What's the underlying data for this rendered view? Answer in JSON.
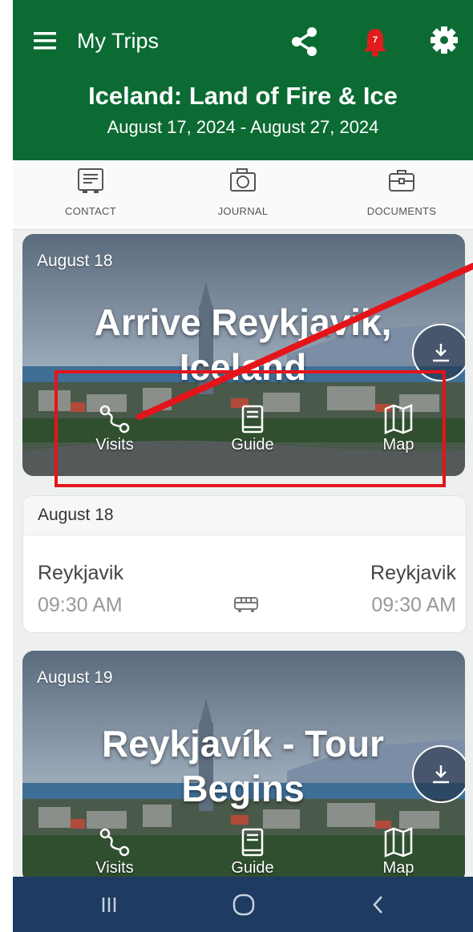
{
  "header": {
    "app_title": "My Trips",
    "notification_count": "7",
    "trip_title": "Iceland: Land of Fire & Ice",
    "trip_dates": "August 17, 2024 - August 27, 2024",
    "background_color": "#0b6b33",
    "icons": [
      "menu-icon",
      "share-icon",
      "bell-icon",
      "gear-icon"
    ]
  },
  "quicknav": {
    "items": [
      {
        "label": "CONTACT",
        "icon": "contact-card-icon"
      },
      {
        "label": "JOURNAL",
        "icon": "camera-icon"
      },
      {
        "label": "DOCUMENTS",
        "icon": "briefcase-icon"
      }
    ]
  },
  "days": [
    {
      "date": "August 18",
      "title_line1": "Arrive Reykjavik,",
      "title_line2": "Iceland",
      "actions": [
        {
          "label": "Visits",
          "icon": "route-icon"
        },
        {
          "label": "Guide",
          "icon": "book-icon"
        },
        {
          "label": "Map",
          "icon": "map-icon"
        }
      ]
    },
    {
      "date": "August 19",
      "title_line1": "Reykjavík - Tour",
      "title_line2": "Begins",
      "actions": [
        {
          "label": "Visits",
          "icon": "route-icon"
        },
        {
          "label": "Guide",
          "icon": "book-icon"
        },
        {
          "label": "Map",
          "icon": "map-icon"
        }
      ]
    }
  ],
  "transfer": {
    "date": "August 18",
    "from_city": "Reykjavik",
    "from_time": "09:30 AM",
    "to_city": "Reykjavik",
    "to_time": "09:30 AM",
    "mode_icon": "bus-icon"
  },
  "annotation": {
    "color": "#e5141b"
  },
  "system_nav": {
    "background_color": "#1e3c62",
    "buttons": [
      "recents-icon",
      "home-icon",
      "back-icon"
    ]
  }
}
